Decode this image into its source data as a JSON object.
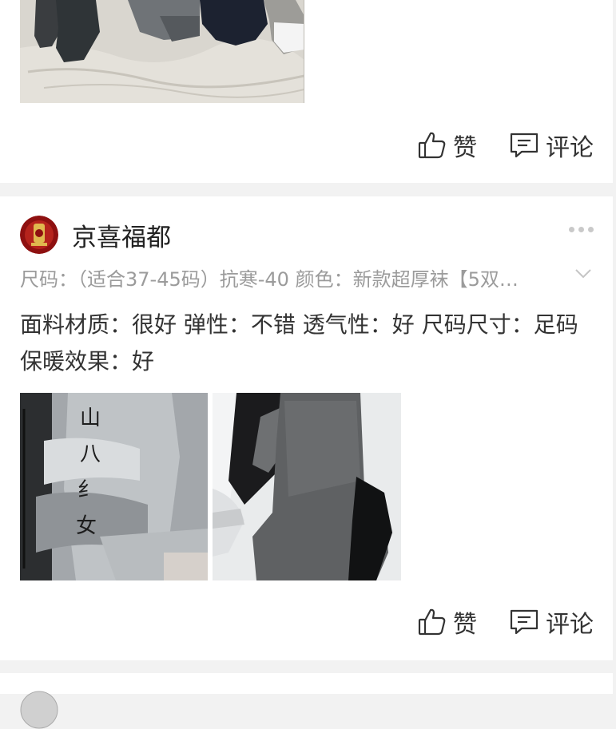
{
  "top_card": {
    "like_label": "赞",
    "comment_label": "评论"
  },
  "review": {
    "username": "京喜福都",
    "spec": "尺码：（适合37-45码）抗寒-40 颜色：新款超厚袜【5双…",
    "text": "面料材质：很好 弹性：不错 透气性：好 尺码尺寸：足码 保暖效果：好",
    "like_label": "赞",
    "comment_label": "评论"
  },
  "icons": {
    "like": "thumbs-up-icon",
    "comment": "comment-icon",
    "more": "more-dots-icon",
    "expand": "chevron-down-icon"
  },
  "colors": {
    "page_bg": "#f2f2f2",
    "card_bg": "#ffffff",
    "text_primary": "#333333",
    "text_secondary": "#9b9b9b",
    "avatar_red": "#8e1010"
  }
}
